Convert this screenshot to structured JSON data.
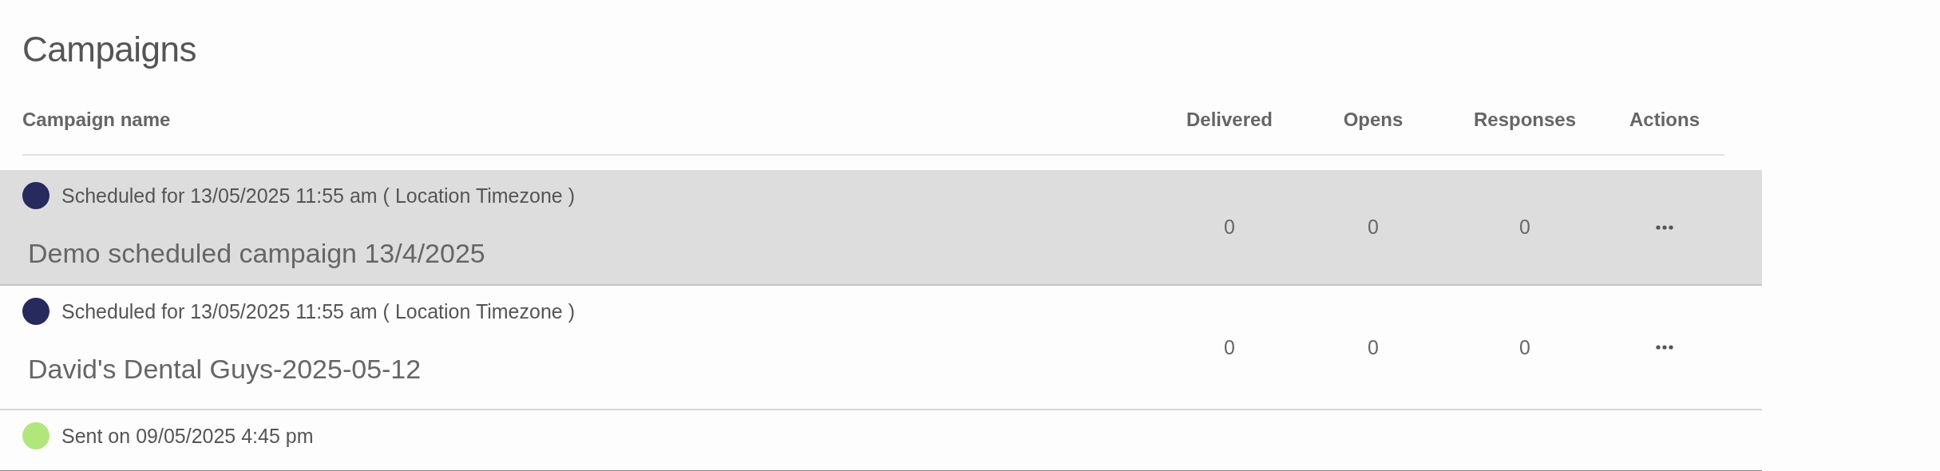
{
  "title": "Campaigns",
  "table": {
    "columns": [
      "Campaign name",
      "Delivered",
      "Opens",
      "Responses",
      "Actions"
    ],
    "rows": [
      {
        "status": "Scheduled for 13/05/2025 11:55 am ( Location Timezone )",
        "color": "#262a5c",
        "name": "Demo scheduled campaign 13/4/2025",
        "delivered": "0",
        "opens": "0",
        "responses": "0",
        "highlighted": true,
        "has_actions": true
      },
      {
        "status": "Scheduled for 13/05/2025 11:55 am ( Location Timezone )",
        "color": "#262a5c",
        "name": "David's Dental Guys-2025-05-12",
        "delivered": "0",
        "opens": "0",
        "responses": "0",
        "highlighted": false,
        "has_actions": true
      },
      {
        "status": "Sent on 09/05/2025 4:45 pm",
        "color": "#b1e67c",
        "highlighted": false,
        "has_actions": false
      }
    ]
  }
}
